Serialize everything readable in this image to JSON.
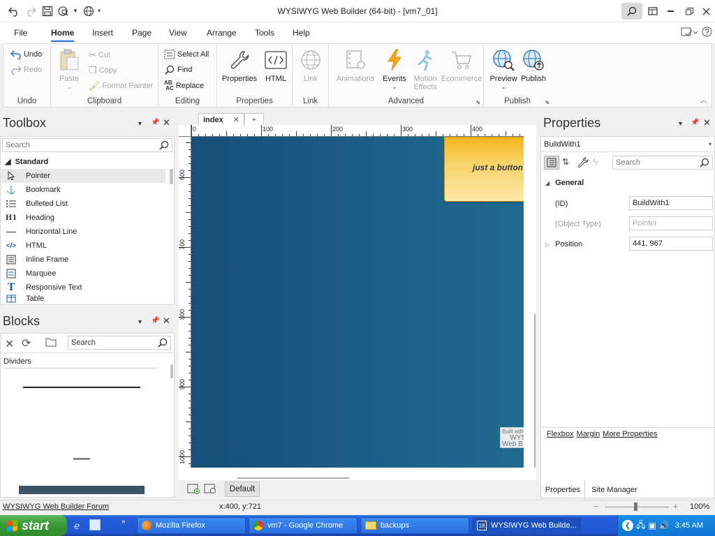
{
  "titlebar": {
    "title": "WYSIWYG Web Builder (64-bit) - [vm7_01]"
  },
  "menu": {
    "tabs": [
      "File",
      "Home",
      "Insert",
      "Page",
      "View",
      "Arrange",
      "Tools",
      "Help"
    ],
    "active": "Home"
  },
  "ribbon": {
    "undo": {
      "undo": "Undo",
      "redo": "Redo",
      "label": "Undo"
    },
    "clipboard": {
      "paste": "Paste",
      "cut": "Cut",
      "copy": "Copy",
      "format_painter": "Format Painter",
      "label": "Clipboard"
    },
    "editing": {
      "select_all": "Select All",
      "find": "Find",
      "replace": "Replace",
      "label": "Editing"
    },
    "properties": {
      "properties": "Properties",
      "html": "HTML",
      "label": "Properties"
    },
    "link": {
      "link": "Link",
      "label": "Link"
    },
    "advanced": {
      "animations": "Animations",
      "events": "Events",
      "motion_effects_1": "Motion",
      "motion_effects_2": "Effects",
      "ecommerce": "Ecommerce",
      "label": "Advanced"
    },
    "publish": {
      "preview": "Preview",
      "publish": "Publish",
      "label": "Publish"
    }
  },
  "toolbox": {
    "title": "Toolbox",
    "search_placeholder": "Search",
    "category": "Standard",
    "items": [
      {
        "label": "Pointer",
        "icon": "pointer-icon"
      },
      {
        "label": "Bookmark",
        "icon": "anchor-icon"
      },
      {
        "label": "Bulleted List",
        "icon": "bulleted-list-icon"
      },
      {
        "label": "Heading",
        "icon": "heading-icon"
      },
      {
        "label": "Horizontal Line",
        "icon": "horizontal-line-icon"
      },
      {
        "label": "HTML",
        "icon": "html-code-icon"
      },
      {
        "label": "Inline Frame",
        "icon": "inline-frame-icon"
      },
      {
        "label": "Marquee",
        "icon": "marquee-icon"
      },
      {
        "label": "Responsive Text",
        "icon": "responsive-text-icon"
      },
      {
        "label": "Table",
        "icon": "table-icon"
      }
    ]
  },
  "blocks": {
    "title": "Blocks",
    "search_placeholder": "Search",
    "category": "Dividers"
  },
  "editor": {
    "tab": "index",
    "ruler_top": [
      "0",
      "100",
      "200",
      "300",
      "400"
    ],
    "ruler_left": [
      "600",
      "700",
      "800",
      "900",
      "1000"
    ],
    "button_text": "just a button",
    "badge_lines": [
      "Built with",
      "WYS",
      "Web B"
    ],
    "breakpoint": "Default"
  },
  "properties": {
    "title": "Properties",
    "object": "BuildWith1",
    "search_placeholder": "Search",
    "group": "General",
    "rows": [
      {
        "name": "(ID)",
        "value": "BuildWith1"
      },
      {
        "name": "(Object Type)",
        "value": "Pointer"
      },
      {
        "name": "Position",
        "value": "441, 967"
      }
    ],
    "links": [
      "Flexbox",
      "Margin",
      "More Properties"
    ],
    "bottom_tabs": [
      "Properties",
      "Site Manager"
    ]
  },
  "status": {
    "forum_link": "WYSIWYG Web Builder Forum",
    "coords": "x:400, y:721",
    "zoom": "100%"
  },
  "taskbar": {
    "start": "start",
    "items": [
      "Mozilla Firefox",
      "vm7 - Google Chrome",
      "backups",
      "WYSIWYG Web Builde..."
    ],
    "clock": "3:45 AM"
  },
  "colors": {
    "accent": "#1e6fd2",
    "design_bg": "#1c5d86",
    "button_gold": "#f4b31b",
    "taskbar": "#245edb"
  }
}
